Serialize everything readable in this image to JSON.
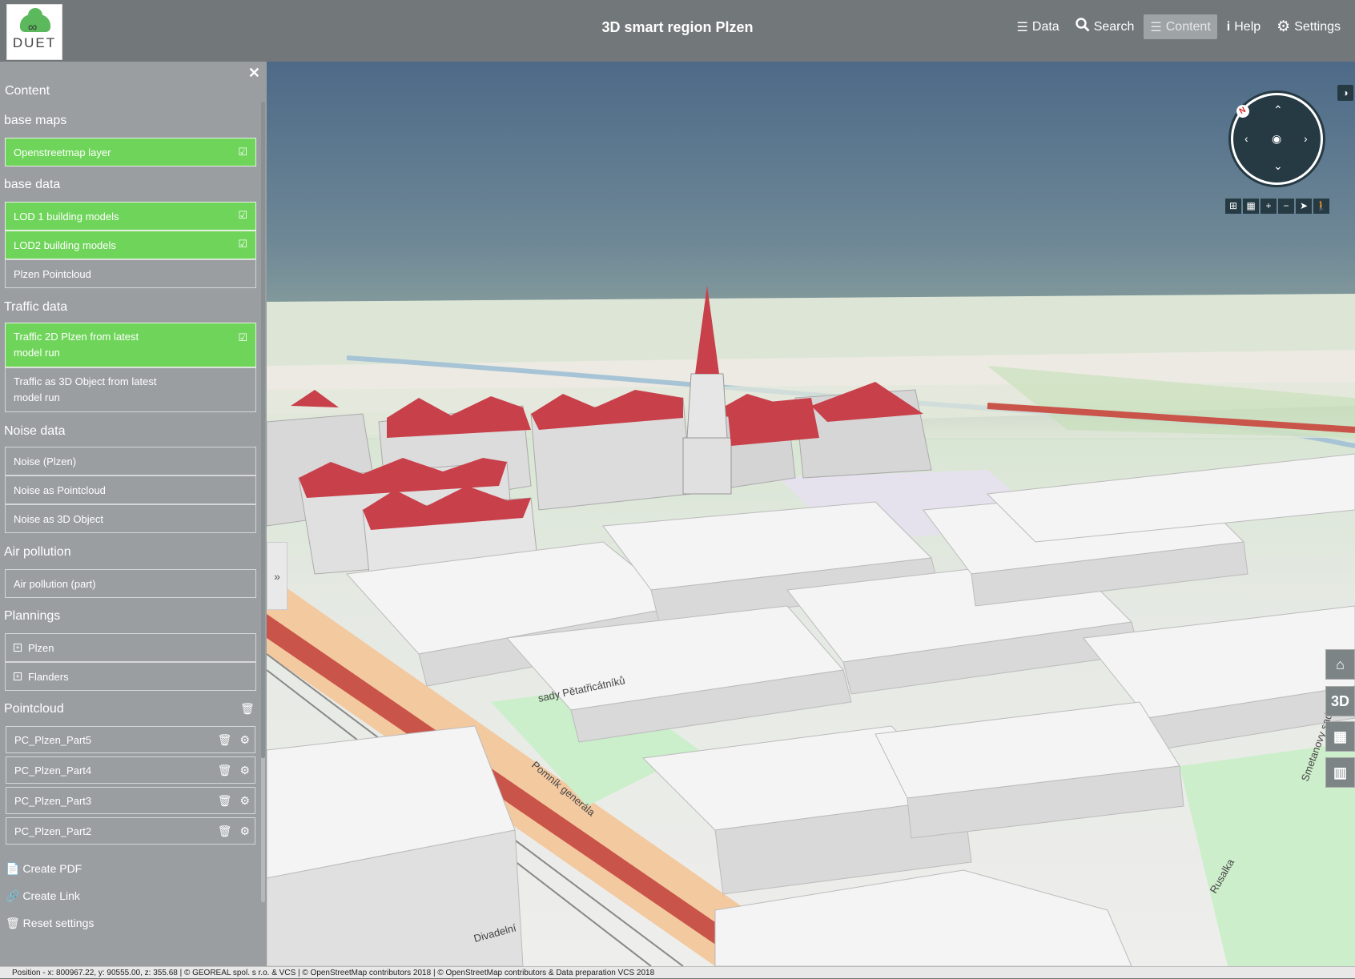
{
  "header": {
    "logo_text": "DUET",
    "title": "3D smart region Plzen",
    "nav": [
      {
        "label": "Data",
        "icon": "list-icon"
      },
      {
        "label": "Search",
        "icon": "search-icon"
      },
      {
        "label": "Content",
        "icon": "menu-icon",
        "active": true
      },
      {
        "label": "Help",
        "icon": "info-icon"
      },
      {
        "label": "Settings",
        "icon": "gear-icon"
      }
    ]
  },
  "sidebar": {
    "title": "Content",
    "base_maps": {
      "title": "base maps",
      "items": [
        {
          "label": "Openstreetmap layer",
          "checked": true
        }
      ]
    },
    "base_data": {
      "title": "base data",
      "items": [
        {
          "label": "LOD 1 building models",
          "checked": true
        },
        {
          "label": "LOD2 building models",
          "checked": true
        },
        {
          "label": "Plzen Pointcloud",
          "checked": false
        }
      ]
    },
    "traffic_data": {
      "title": "Traffic data",
      "items": [
        {
          "label": "Traffic 2D Plzen from latest model run",
          "checked": true
        },
        {
          "label": "Traffic as 3D Object from latest model run",
          "checked": false
        }
      ]
    },
    "noise_data": {
      "title": "Noise data",
      "items": [
        {
          "label": "Noise (Plzen)"
        },
        {
          "label": "Noise as Pointcloud"
        },
        {
          "label": "Noise as 3D Object"
        }
      ]
    },
    "air_pollution": {
      "title": "Air pollution",
      "items": [
        {
          "label": "Air pollution (part)"
        }
      ]
    },
    "plannings": {
      "title": "Plannings",
      "items": [
        {
          "label": "Plzen"
        },
        {
          "label": "Flanders"
        }
      ]
    },
    "pointcloud": {
      "title": "Pointcloud",
      "items": [
        {
          "label": "PC_Plzen_Part5"
        },
        {
          "label": "PC_Plzen_Part4"
        },
        {
          "label": "PC_Plzen_Part3"
        },
        {
          "label": "PC_Plzen_Part2"
        }
      ]
    },
    "actions": [
      {
        "label": "Create PDF",
        "icon": "pdf-icon"
      },
      {
        "label": "Create Link",
        "icon": "link-icon"
      },
      {
        "label": "Reset settings",
        "icon": "trash-icon"
      }
    ]
  },
  "map": {
    "compass_north": "N",
    "side_buttons": {
      "home": "⌂",
      "three_d": "3D",
      "grid": "▦",
      "map": "▥"
    },
    "labels": [
      "sady Pětatřicátníků",
      "Pomník generála",
      "Rusalka",
      "Divadelní",
      "Smetanovy sady"
    ]
  },
  "status_bar": "Position - x: 800967.22, y: 90555.00, z: 355.68 | © GEOREAL spol. s r.o. & VCS | © OpenStreetMap contributors 2018 | © OpenStreetMap contributors & Data preparation VCS 2018",
  "colors": {
    "header_bg": "#727779",
    "sidebar_bg": "#9a9ea1",
    "active_item": "#6fd55a",
    "roof_red": "#c8404a",
    "compass_bg": "#263a44"
  }
}
